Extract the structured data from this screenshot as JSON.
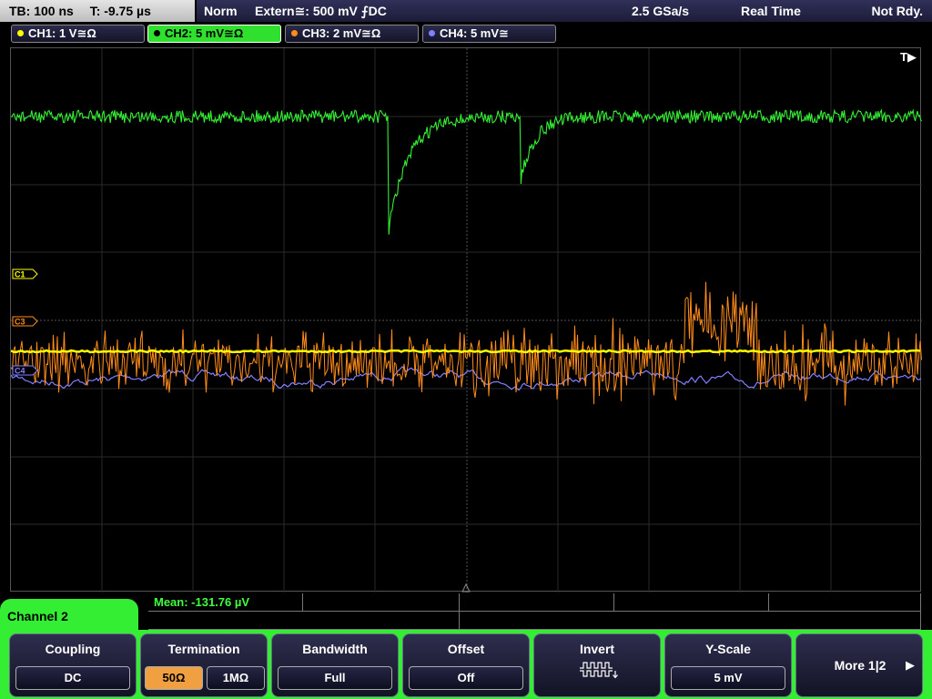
{
  "status": {
    "timebase": "TB: 100 ns",
    "trigger_time": "T: -9.75 µs",
    "trigger_mode": "Norm",
    "trigger_source": "Extern≅: 500 mV ⨍DC",
    "sample_rate": "2.5 GSa/s",
    "acq_mode": "Real Time",
    "run_state": "Not Rdy."
  },
  "channels": [
    {
      "label": "CH1: 1 V≅Ω",
      "color": "#ffff00",
      "active": false
    },
    {
      "label": "CH2: 5 mV≅Ω",
      "color": "#33ee33",
      "active": true
    },
    {
      "label": "CH3: 2 mV≅Ω",
      "color": "#ff8c1a",
      "active": false
    },
    {
      "label": "CH4: 5 mV≅",
      "color": "#8080ff",
      "active": false
    }
  ],
  "display": {
    "trigger_marker": "T▶",
    "channel_markers": [
      {
        "text": "C1",
        "color": "#ffff00"
      },
      {
        "text": "C3",
        "color": "#ff8c1a"
      },
      {
        "text": "C4",
        "color": "#8080ff"
      }
    ]
  },
  "measurement": {
    "mean": "Mean: -131.76 µV"
  },
  "softkeys": {
    "menu_title": "Channel 2",
    "coupling": {
      "title": "Coupling",
      "value": "DC"
    },
    "termination": {
      "title": "Termination",
      "options": [
        "50Ω",
        "1MΩ"
      ],
      "selected": "50Ω"
    },
    "bandwidth": {
      "title": "Bandwidth",
      "value": "Full"
    },
    "offset": {
      "title": "Offset",
      "value": "Off"
    },
    "invert": {
      "title": "Invert",
      "icon": "invert-waveform-icon"
    },
    "yscale": {
      "title": "Y-Scale",
      "value": "5 mV"
    },
    "more": {
      "label": "More 1|2",
      "icon": "arrow-right-icon"
    }
  }
}
